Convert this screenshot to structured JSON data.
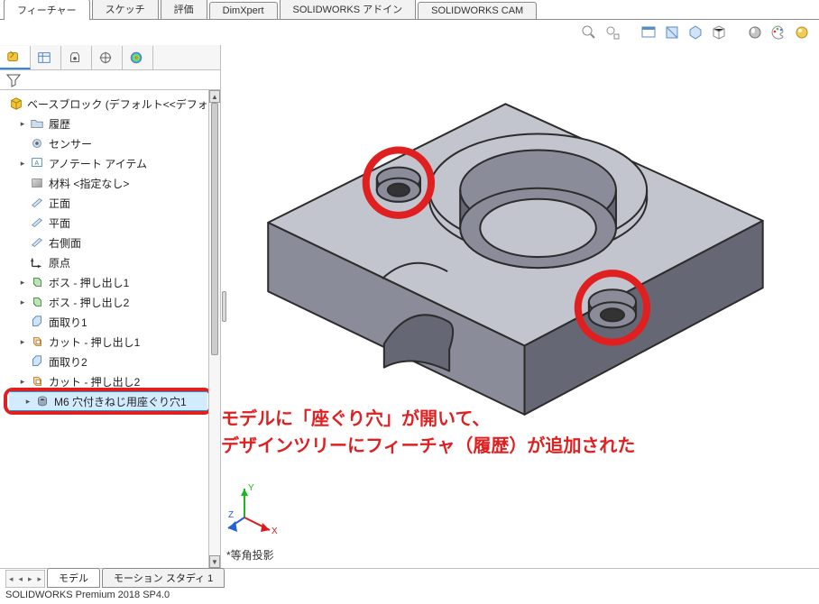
{
  "menu_tabs": {
    "items": [
      "フィーチャー",
      "スケッチ",
      "評価",
      "DimXpert",
      "SOLIDWORKS アドイン",
      "SOLIDWORKS CAM"
    ],
    "active_index": 0
  },
  "fm_tabs": {
    "icons": [
      "feature-tree-icon",
      "property-icon",
      "config-icon",
      "dimxpert-tab-icon",
      "appearance-tab-icon"
    ],
    "active_index": 0
  },
  "view_toolbar_icons": [
    "zoom-area-icon",
    "zoom-fit-icon",
    "view-window-icon",
    "section-view-icon",
    "view-orientation-icon",
    "cube-view-icon",
    "display-style-icon",
    "color-palette-icon",
    "render-icon"
  ],
  "tree": {
    "root": {
      "label": "ベースブロック (デフォルト<<デフォルト>_表示",
      "icon": "part-icon"
    },
    "items": [
      {
        "indent": 1,
        "exp": "▸",
        "label": "履歴",
        "icon": "folder-icon"
      },
      {
        "indent": 1,
        "exp": "",
        "label": "センサー",
        "icon": "sensor-icon"
      },
      {
        "indent": 1,
        "exp": "▸",
        "label": "アノテート アイテム",
        "icon": "annotation-icon"
      },
      {
        "indent": 1,
        "exp": "",
        "label": "材料 <指定なし>",
        "icon": "material-icon"
      },
      {
        "indent": 1,
        "exp": "",
        "label": "正面",
        "icon": "plane-icon"
      },
      {
        "indent": 1,
        "exp": "",
        "label": "平面",
        "icon": "plane-icon"
      },
      {
        "indent": 1,
        "exp": "",
        "label": "右側面",
        "icon": "plane-icon"
      },
      {
        "indent": 1,
        "exp": "",
        "label": "原点",
        "icon": "origin-icon"
      },
      {
        "indent": 1,
        "exp": "▸",
        "label": "ボス - 押し出し1",
        "icon": "extrude-icon"
      },
      {
        "indent": 1,
        "exp": "▸",
        "label": "ボス - 押し出し2",
        "icon": "extrude-icon"
      },
      {
        "indent": 1,
        "exp": "",
        "label": "面取り1",
        "icon": "chamfer-icon"
      },
      {
        "indent": 1,
        "exp": "▸",
        "label": "カット - 押し出し1",
        "icon": "cut-icon"
      },
      {
        "indent": 1,
        "exp": "",
        "label": "面取り2",
        "icon": "chamfer-icon"
      },
      {
        "indent": 1,
        "exp": "▸",
        "label": "カット - 押し出し2",
        "icon": "cut-icon"
      }
    ],
    "highlighted_item": {
      "indent": 1,
      "exp": "▸",
      "label": "M6 穴付きねじ用座ぐり穴1",
      "icon": "hole-icon"
    }
  },
  "annotation": {
    "line1": "モデルに「座ぐり穴」が開いて、",
    "line2": "デザインツリーにフィーチャ（履歴）が追加された"
  },
  "viewport": {
    "viewname_prefix": "*",
    "viewname": "等角投影"
  },
  "bottom_tabs": {
    "items": [
      "モデル",
      "モーション スタディ 1"
    ],
    "active_index": 0
  },
  "status_bar": "SOLIDWORKS Premium 2018 SP4.0",
  "colors": {
    "red": "#e02020",
    "blue": "#2f8bd8"
  }
}
